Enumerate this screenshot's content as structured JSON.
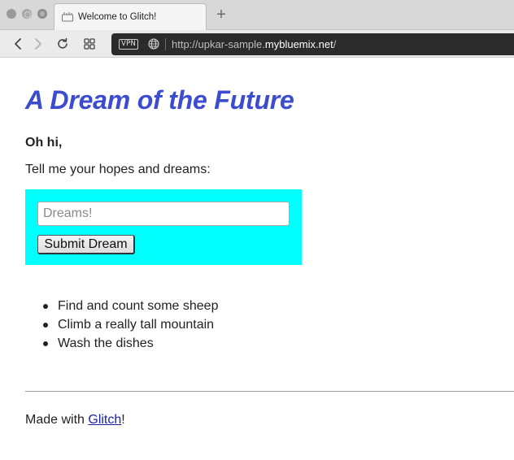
{
  "browser": {
    "tab": {
      "title": "Welcome to Glitch!",
      "favicon": "glitch-favicon"
    },
    "new_tab_label": "+",
    "vpn_label": "VPN",
    "url": {
      "prefix": "http://upkar-sample.",
      "host": "mybluemix.net",
      "suffix": "/"
    }
  },
  "page": {
    "title": "A Dream of the Future",
    "greeting": "Oh hi,",
    "prompt": "Tell me your hopes and dreams:",
    "form": {
      "input_placeholder": "Dreams!",
      "input_value": "",
      "submit_label": "Submit Dream",
      "background_color": "#00ffff"
    },
    "dreams": [
      "Find and count some sheep",
      "Climb a really tall mountain",
      "Wash the dishes"
    ],
    "footer": {
      "prefix": "Made with ",
      "link_text": "Glitch",
      "suffix": "!"
    },
    "colors": {
      "title": "#3c4ccf",
      "link": "#1b1fa8"
    }
  }
}
